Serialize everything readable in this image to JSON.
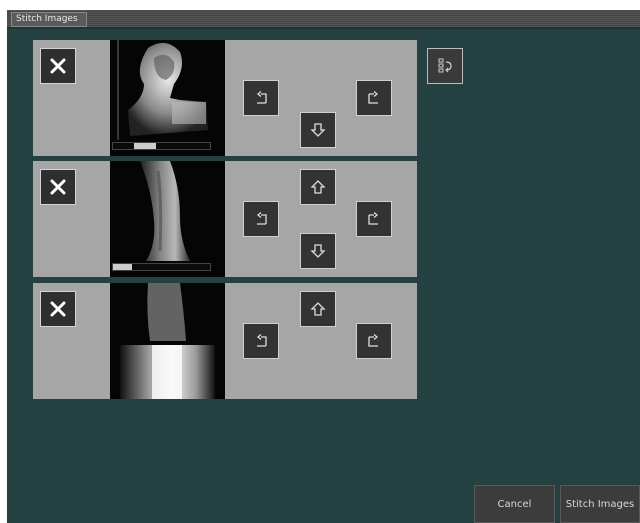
{
  "window": {
    "title": "Stitch Images"
  },
  "panels": [
    {
      "image": "x-ray-skull-neck",
      "progress": 0.22
    },
    {
      "image": "x-ray-spine",
      "progress": 0.2
    },
    {
      "image": "x-ray-pelvis",
      "progress": null
    }
  ],
  "icons": {
    "remove": "close-icon",
    "rotate_left": "rotate-left-icon",
    "rotate_right": "rotate-right-icon",
    "move_up": "arrow-up-icon",
    "move_down": "arrow-down-icon",
    "reorder": "reorder-icon"
  },
  "footer": {
    "cancel_label": "Cancel",
    "stitch_label": "Stitch Images"
  },
  "colors": {
    "background": "#244142",
    "panel": "#a6a6a6",
    "button": "#333333"
  }
}
